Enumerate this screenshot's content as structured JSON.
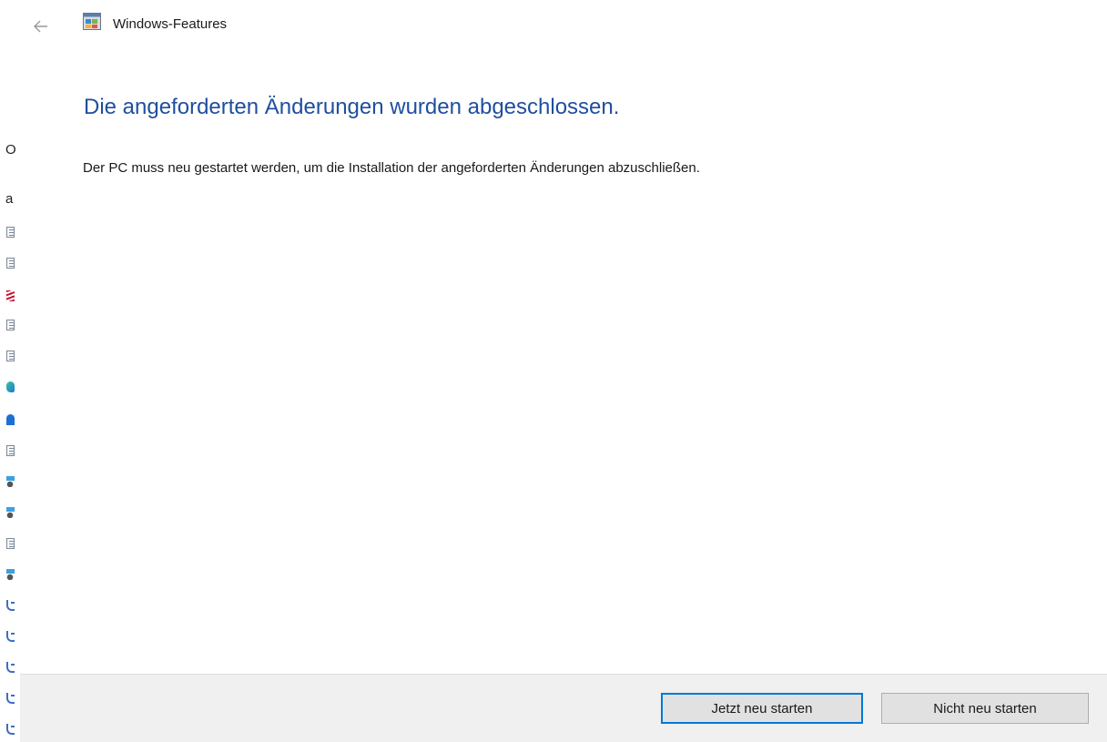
{
  "dialog": {
    "title": "Windows-Features",
    "heading": "Die angeforderten Änderungen wurden abgeschlossen.",
    "message": "Der PC muss neu gestartet werden, um die Installation der angeforderten Änderungen abzuschließen."
  },
  "footer": {
    "restart_now_label": "Jetzt neu starten",
    "no_restart_label": "Nicht neu starten"
  },
  "background_window": {
    "text_fragments": [
      "O",
      "a"
    ],
    "icons": [
      "document-icon",
      "document-icon",
      "red-striped-icon",
      "document-icon",
      "document-icon",
      "edge-icon",
      "blue-icon",
      "document-icon",
      "setup-icon",
      "setup-icon",
      "document-icon",
      "setup-icon",
      "registry-icon",
      "registry-icon",
      "registry-icon",
      "registry-icon",
      "registry-icon"
    ]
  },
  "icons": {
    "back": "back-arrow-icon",
    "app": "windows-features-icon"
  },
  "colors": {
    "heading": "#1f4e9e",
    "primary_button_border": "#0078d7",
    "footer_background": "#f0f0f0"
  }
}
